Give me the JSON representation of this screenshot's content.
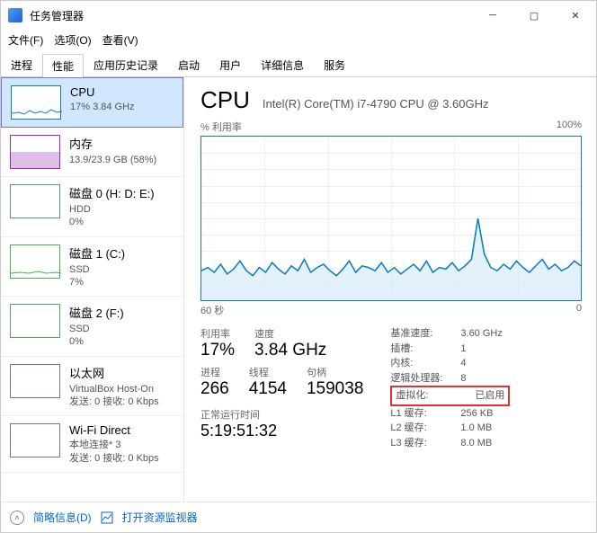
{
  "window": {
    "title": "任务管理器"
  },
  "menu": {
    "file": "文件(F)",
    "options": "选项(O)",
    "view": "查看(V)"
  },
  "tabs": [
    "进程",
    "性能",
    "应用历史记录",
    "启动",
    "用户",
    "详细信息",
    "服务"
  ],
  "active_tab": 1,
  "sidebar": [
    {
      "name": "CPU",
      "sub": "17% 3.84 GHz",
      "color": "blue",
      "sel": true
    },
    {
      "name": "内存",
      "sub": "13.9/23.9 GB (58%)",
      "color": "purple"
    },
    {
      "name": "磁盘 0 (H: D: E:)",
      "sub": "HDD\n0%",
      "color": "green"
    },
    {
      "name": "磁盘 1 (C:)",
      "sub": "SSD\n7%",
      "color": "green"
    },
    {
      "name": "磁盘 2 (F:)",
      "sub": "SSD\n0%",
      "color": "green"
    },
    {
      "name": "以太网",
      "sub": "VirtualBox Host-On\n发送: 0 接收: 0 Kbps",
      "color": "brown"
    },
    {
      "name": "Wi-Fi Direct",
      "sub": "本地连接* 3\n发送: 0 接收: 0 Kbps",
      "color": "brown"
    }
  ],
  "main": {
    "title": "CPU",
    "model": "Intel(R) Core(TM) i7-4790 CPU @ 3.60GHz",
    "chart_tl": "% 利用率",
    "chart_tr": "100%",
    "chart_bl": "60 秒",
    "chart_br": "0",
    "util_lbl": "利用率",
    "util_val": "17%",
    "speed_lbl": "速度",
    "speed_val": "3.84 GHz",
    "proc_lbl": "进程",
    "proc_val": "266",
    "thr_lbl": "线程",
    "thr_val": "4154",
    "hnd_lbl": "句柄",
    "hnd_val": "159038",
    "uptime_lbl": "正常运行时间",
    "uptime_val": "5:19:51:32",
    "specs": [
      {
        "k": "基准速度:",
        "v": "3.60 GHz"
      },
      {
        "k": "插槽:",
        "v": "1"
      },
      {
        "k": "内核:",
        "v": "4"
      },
      {
        "k": "逻辑处理器:",
        "v": "8"
      },
      {
        "k": "虚拟化:",
        "v": "已启用",
        "hl": true
      },
      {
        "k": "L1 缓存:",
        "v": "256 KB"
      },
      {
        "k": "L2 缓存:",
        "v": "1.0 MB"
      },
      {
        "k": "L3 缓存:",
        "v": "8.0 MB"
      }
    ]
  },
  "footer": {
    "brief": "简略信息(D)",
    "resmon": "打开资源监视器"
  },
  "chart_data": {
    "type": "line",
    "title": "% 利用率",
    "ylabel": "% 利用率",
    "ylim": [
      0,
      100
    ],
    "xlabel": "",
    "xlim_label": "60 秒",
    "values": [
      18,
      20,
      17,
      22,
      16,
      19,
      24,
      18,
      15,
      20,
      17,
      23,
      19,
      16,
      21,
      18,
      25,
      17,
      20,
      22,
      18,
      15,
      19,
      24,
      17,
      21,
      20,
      18,
      23,
      17,
      20,
      16,
      19,
      22,
      18,
      24,
      17,
      20,
      19,
      23,
      18,
      21,
      25,
      50,
      28,
      20,
      18,
      22,
      19,
      24,
      20,
      17,
      21,
      25,
      19,
      22,
      18,
      20,
      24,
      21
    ]
  }
}
